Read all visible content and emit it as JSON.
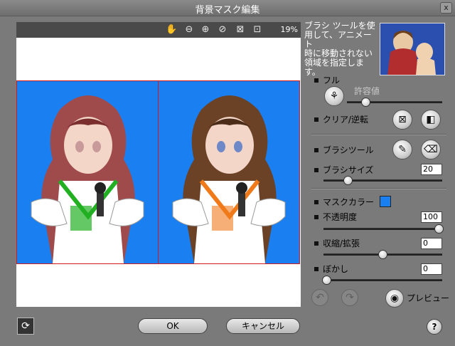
{
  "window": {
    "title": "背景マスク編集",
    "close_label": "x"
  },
  "canvas": {
    "zoom": "19%",
    "tools": [
      "hand-icon",
      "zoom-out-icon",
      "zoom-in-icon",
      "no-mask-icon",
      "fit-icon",
      "actual-size-icon"
    ]
  },
  "help": {
    "text_lines": [
      "ブラシ ツールを使",
      "用して、アニメート",
      "時に移動されない",
      "領域を指定します。"
    ]
  },
  "panel": {
    "full_label": "フル",
    "tolerance_label": "許容値",
    "clear_invert_label": "クリア/逆転",
    "brush_tool_label": "ブラシツール",
    "brush_size_label": "ブラシサイズ",
    "brush_size_value": "20",
    "mask_color_label": "マスクカラー",
    "opacity_label": "不透明度",
    "opacity_value": "100",
    "shrink_expand_label": "収縮/拡張",
    "shrink_expand_value": "0",
    "blur_label": "ぼかし",
    "blur_value": "0",
    "preview_label": "プレビュー"
  },
  "colors": {
    "mask": "#1a7ff0",
    "border": "#d21a1a"
  },
  "footer": {
    "ok_label": "OK",
    "cancel_label": "キャンセル",
    "help_label": "?"
  }
}
